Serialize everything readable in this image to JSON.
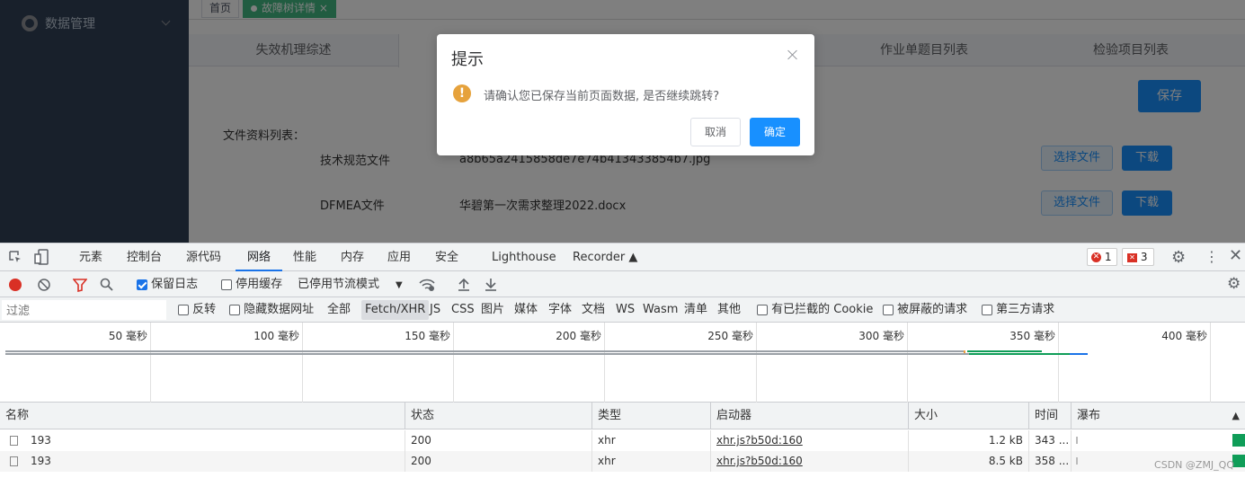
{
  "sidebar": {
    "item_label": "数据管理",
    "icon": "gear-icon"
  },
  "tags": {
    "home": "首页",
    "active": "故障树详情",
    "close": "×"
  },
  "tabs": [
    "失效机理综述",
    "",
    "",
    "作业单题目列表",
    "检验项目列表"
  ],
  "main": {
    "save_button": "保存",
    "file_list_label": "文件资料列表：",
    "files": [
      {
        "name": "技术规范文件",
        "file": "a8b65a2415858de7e74b413433854b7.jpg",
        "choose": "选择文件",
        "download": "下载"
      },
      {
        "name": "DFMEA文件",
        "file": "华碧第一次需求整理2022.docx",
        "choose": "选择文件",
        "download": "下载"
      }
    ]
  },
  "dialog": {
    "title": "提示",
    "message": "请确认您已保存当前页面数据, 是否继续跳转?",
    "cancel": "取消",
    "ok": "确定",
    "warn_glyph": "!"
  },
  "devtools": {
    "tabs": [
      "元素",
      "控制台",
      "源代码",
      "网络",
      "性能",
      "内存",
      "应用",
      "安全",
      "Lighthouse",
      "Recorder"
    ],
    "active_tab": "网络",
    "error_count": "1",
    "warn_count": "3",
    "toolbar": {
      "preserve_log": "保留日志",
      "disable_cache": "停用缓存",
      "throttle": "已停用节流模式"
    },
    "filter": {
      "placeholder": "过滤",
      "invert": "反转",
      "hide_data_urls": "隐藏数据网址",
      "types": [
        "全部",
        "Fetch/XHR",
        "JS",
        "CSS",
        "图片",
        "媒体",
        "字体",
        "文档",
        "WS",
        "Wasm",
        "清单",
        "其他"
      ],
      "blocked_cookies": "有已拦截的 Cookie",
      "blocked_requests": "被屏蔽的请求",
      "third_party": "第三方请求"
    },
    "timeline_ticks": [
      "50 毫秒",
      "100 毫秒",
      "150 毫秒",
      "200 毫秒",
      "250 毫秒",
      "300 毫秒",
      "350 毫秒",
      "400 毫秒"
    ],
    "columns": [
      "名称",
      "状态",
      "类型",
      "启动器",
      "大小",
      "时间",
      "瀑布"
    ],
    "sort_glyph": "▲",
    "rows": [
      {
        "name": "193",
        "status": "200",
        "type": "xhr",
        "initiator": "xhr.js?b50d:160",
        "size": "1.2 kB",
        "time": "343 ..."
      },
      {
        "name": "193",
        "status": "200",
        "type": "xhr",
        "initiator": "xhr.js?b50d:160",
        "size": "8.5 kB",
        "time": "358 ..."
      }
    ]
  },
  "watermark": "CSDN @ZMJ_QQ"
}
